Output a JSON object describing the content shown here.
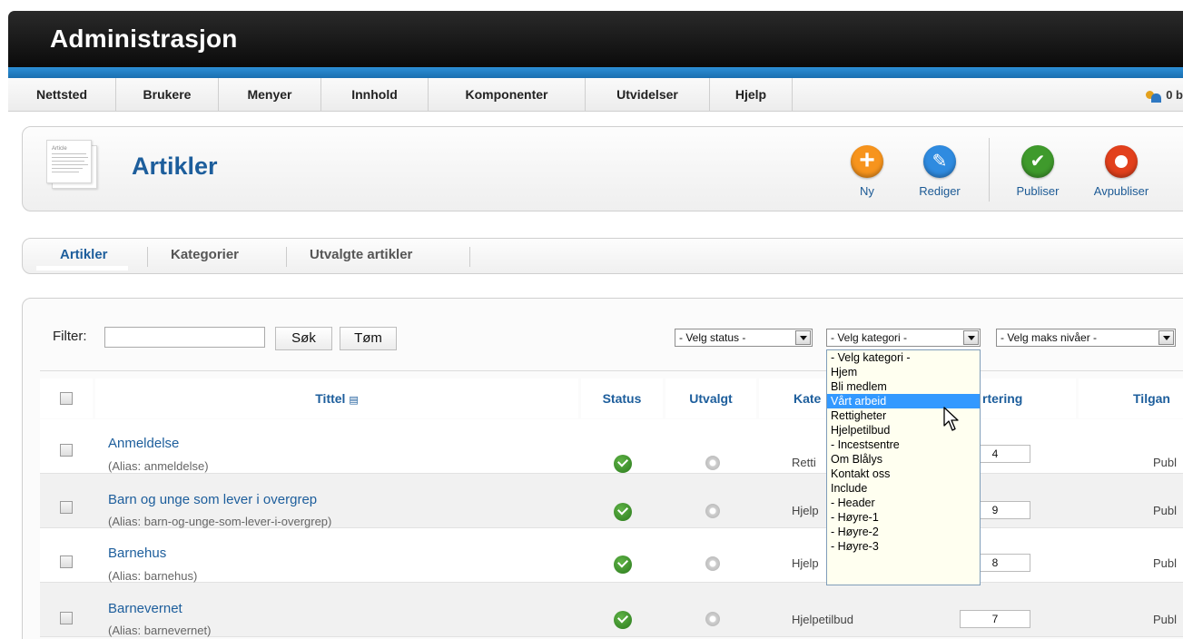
{
  "header": {
    "title": "Administrasjon"
  },
  "menu": {
    "items": [
      "Nettsted",
      "Brukere",
      "Menyer",
      "Innhold",
      "Komponenter",
      "Utvidelser",
      "Hjelp"
    ],
    "user_text": "0 b"
  },
  "toolbar": {
    "heading": "Artikler",
    "icon_label": "Article",
    "buttons": [
      {
        "label": "Ny",
        "color": "#f7941d",
        "icon": "plus-icon"
      },
      {
        "label": "Rediger",
        "color": "#2f8be0",
        "icon": "pencil-icon"
      },
      {
        "label": "Publiser",
        "color": "#3f9a2c",
        "icon": "check-icon"
      },
      {
        "label": "Avpubliser",
        "color": "#e2401c",
        "icon": "circle-icon"
      }
    ]
  },
  "submenu": {
    "items": [
      "Artikler",
      "Kategorier",
      "Utvalgte artikler"
    ],
    "active": "Artikler"
  },
  "filter": {
    "label": "Filter:",
    "value": "",
    "search_label": "Søk",
    "clear_label": "Tøm",
    "status_select": "- Velg status -",
    "category_select": "- Velg kategori -",
    "level_select": "- Velg maks nivåer -"
  },
  "table": {
    "headers": {
      "title": "Tittel",
      "status": "Status",
      "featured": "Utvalgt",
      "category": "Kate",
      "ordering": "rtering",
      "access": "Tilgan"
    },
    "rows": [
      {
        "title": "Anmeldelse",
        "alias": "(Alias: anmeldelse)",
        "category": "Retti",
        "order": "4",
        "access": "Publ"
      },
      {
        "title": "Barn og unge som lever i overgrep",
        "alias": "(Alias: barn-og-unge-som-lever-i-overgrep)",
        "category": "Hjelp",
        "order": "9",
        "access": "Publ"
      },
      {
        "title": "Barnehus",
        "alias": "(Alias: barnehus)",
        "category": "Hjelp",
        "order": "8",
        "access": "Publ"
      },
      {
        "title": "Barnevernet",
        "alias": "(Alias: barnevernet)",
        "category": "Hjelpetilbud",
        "order": "7",
        "access": "Publ"
      }
    ]
  },
  "dropdown": {
    "options": [
      "- Velg kategori -",
      "Hjem",
      "Bli medlem",
      "Vårt arbeid",
      "Rettigheter",
      "Hjelpetilbud",
      "- Incestsentre",
      "Om Blålys",
      "Kontakt oss",
      "Include",
      "- Header",
      "- Høyre-1",
      "- Høyre-2",
      "- Høyre-3"
    ],
    "highlighted": "Vårt arbeid"
  }
}
